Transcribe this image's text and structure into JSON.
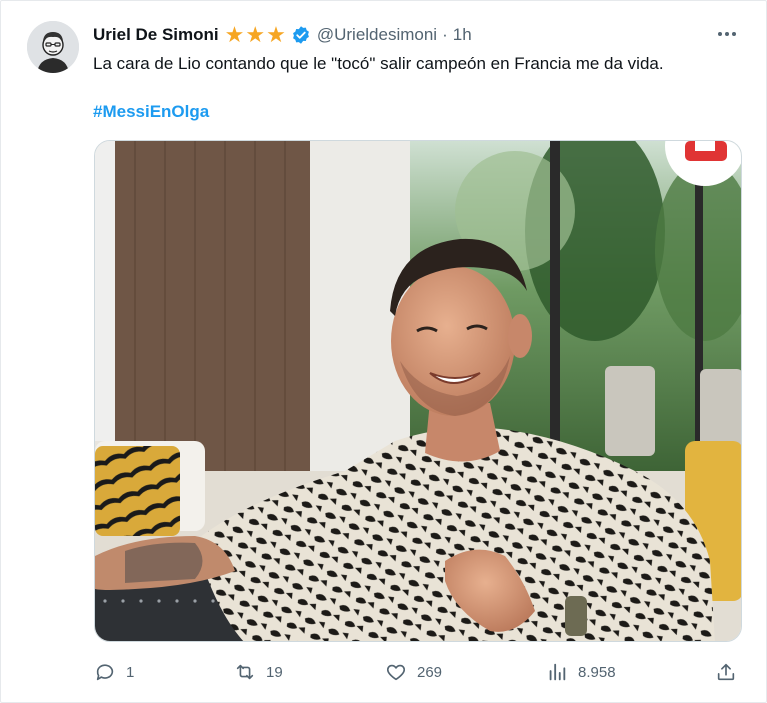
{
  "tweet": {
    "display_name": "Uriel De Simoni",
    "handle": "@Urieldesimoni",
    "separator": "·",
    "time": "1h",
    "text": "La cara de Lio contando que le \"tocó\" salir campeón en Francia me da vida.",
    "hashtag": "#MessiEnOlga",
    "badges": {
      "star_count": 3,
      "star_color": "#f6a623",
      "verified_color": "#1d9bf0"
    }
  },
  "actions": {
    "replies": "1",
    "retweets": "19",
    "likes": "269",
    "views": "8.958"
  },
  "icons": {
    "avatar": "avatar-cartoon-icon",
    "more": "more-dots-icon",
    "reply": "reply-icon",
    "retweet": "retweet-icon",
    "like": "heart-icon",
    "views": "views-bar-chart-icon",
    "share": "share-icon"
  },
  "colors": {
    "text_primary": "#0f1419",
    "text_secondary": "#536471",
    "link": "#1d9bf0",
    "border": "#cfd9de"
  }
}
